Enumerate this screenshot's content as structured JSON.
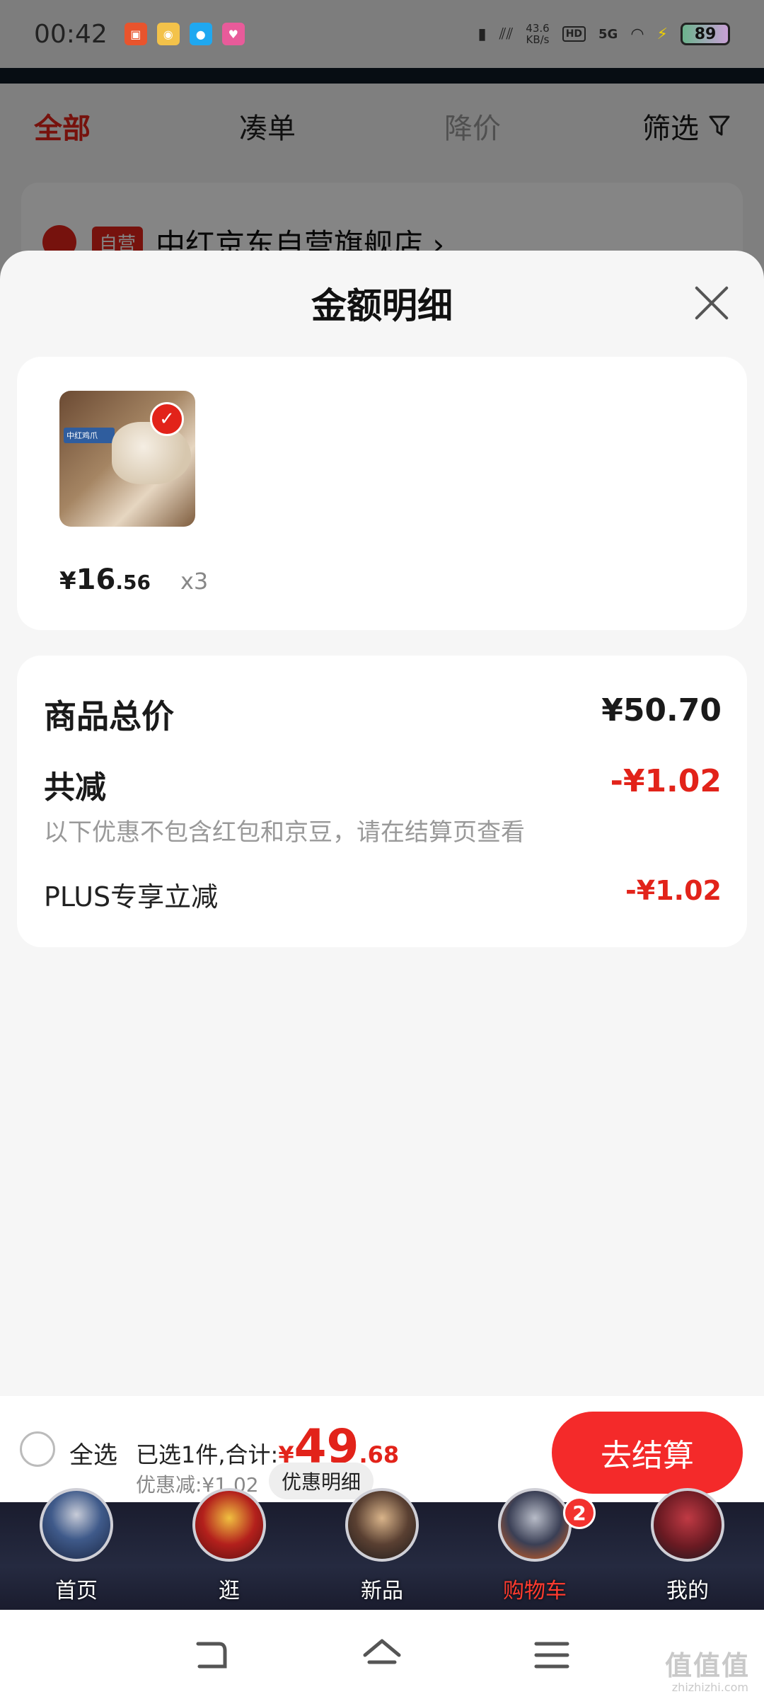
{
  "status_bar": {
    "time": "00:42",
    "net_speed_value": "43.6",
    "net_speed_unit": "KB/s",
    "hd": "HD",
    "signal": "5G",
    "battery": "89"
  },
  "background_page": {
    "tabs": [
      "全部",
      "凑单",
      "降价"
    ],
    "filter_label": "筛选",
    "store_tag": "自营",
    "store_name": "中红京东自营旗舰店 ›"
  },
  "sheet": {
    "title": "金额明细",
    "product": {
      "image_label": "中红鸡爪",
      "price_yen": "¥",
      "price_int": "16",
      "price_dec": ".56",
      "quantity": "x3"
    },
    "summary": {
      "total_label": "商品总价",
      "total_value": "¥50.70",
      "reduce_label": "共减",
      "reduce_value": "-¥1.02",
      "note": "以下优惠不包含红包和京豆，请在结算页查看",
      "plus_label": "PLUS专享立减",
      "plus_value": "-¥1.02"
    }
  },
  "checkout": {
    "select_all": "全选",
    "selected_prefix": "已选1件,合计:",
    "total_yen": "¥",
    "total_int": "49",
    "total_dec": ".68",
    "discount": "优惠减:¥1.02",
    "detail_chip": "优惠明细",
    "checkout_button": "去结算"
  },
  "tab_bar": {
    "items": [
      {
        "label": "首页"
      },
      {
        "label": "逛"
      },
      {
        "label": "新品"
      },
      {
        "label": "购物车",
        "badge": "2"
      },
      {
        "label": "我的"
      }
    ]
  },
  "watermark": {
    "main": "值值值",
    "sub": "zhizhizhi.com"
  },
  "colors": {
    "accent_red": "#e2231a",
    "checkout_red": "#f42a2a"
  }
}
